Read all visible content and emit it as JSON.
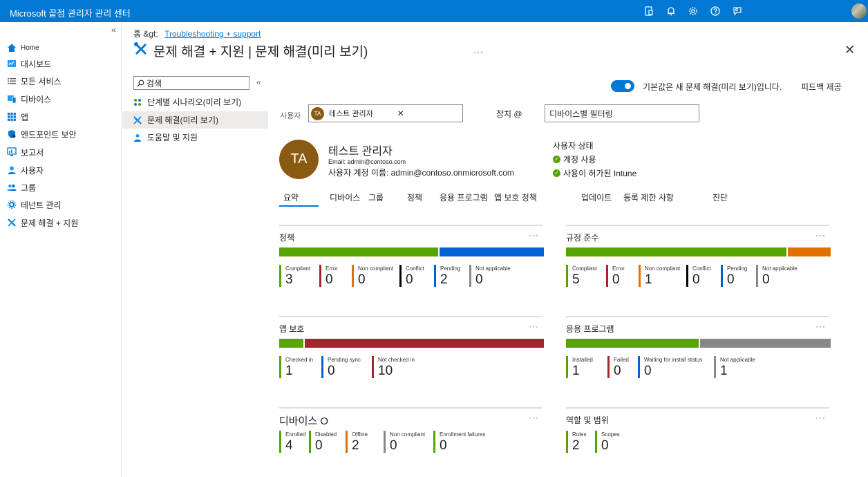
{
  "topbar": {
    "title": "Microsoft 끝점 관리자 관리 센터"
  },
  "nav": {
    "collapse": "«",
    "items": [
      {
        "label": "Home"
      },
      {
        "label": "대시보드"
      },
      {
        "label": "모든 서비스"
      },
      {
        "label": "디바이스"
      },
      {
        "label": "앱"
      },
      {
        "label": "엔드포인트 보안"
      },
      {
        "label": "보고서"
      },
      {
        "label": "사용자"
      },
      {
        "label": "그룹"
      },
      {
        "label": "테넌트 관리"
      },
      {
        "label": "문제 해결 + 지원"
      }
    ]
  },
  "breadcrumb": {
    "home": "홈 &gt;",
    "current": "Troubleshooting + support"
  },
  "page": {
    "title": "문제 해결 + 지원 | 문제 해결(미리 보기)",
    "more": "...",
    "close": "✕"
  },
  "subnav": {
    "search_placeholder": "검색",
    "collapse": "«",
    "items": [
      {
        "label": "단계별 시나리오(미리 보기)"
      },
      {
        "label": "문제 해결(미리 보기)"
      },
      {
        "label": "도움말 및 지원"
      }
    ]
  },
  "toggle": {
    "label": "기본값은 새 문제 해결(미리 보기)입니다.",
    "feedback": "피드백 제공"
  },
  "filters": {
    "user_label": "사용자",
    "user_initials": "TA",
    "user_name": "테스트 관리자",
    "user_remove": "✕",
    "device_label": "장치 @",
    "device_placeholder": "디바이스별 필터링"
  },
  "profile": {
    "initials": "TA",
    "name": "테스트 관리자",
    "email": "Email: admin@contoso.com",
    "upn": "사용자 계정 이름: admin@contoso.onmicrosoft.com",
    "status_title": "사용자 상태",
    "status": [
      "계정 사용",
      "사용이 허가된 Intune"
    ]
  },
  "tabs": [
    "요약",
    "디바이스",
    "그룹",
    "정책",
    "응용 프로그램",
    "앱 보호 정책",
    "업데이트",
    "등록 제한 사항",
    "진단"
  ],
  "cards": {
    "policy": {
      "title": "정책",
      "more": "···",
      "bar": [
        {
          "value": 3,
          "color": "#57a300"
        },
        {
          "value": 2,
          "color": "#0063d4"
        }
      ],
      "stats": [
        {
          "label": "Compliant",
          "value": "3",
          "color": "#57a300"
        },
        {
          "label": "Error",
          "value": "0",
          "color": "#a4262c"
        },
        {
          "label": "Non compliant",
          "value": "0",
          "color": "#e07000"
        },
        {
          "label": "Conflict",
          "value": "0",
          "color": "#000000"
        },
        {
          "label": "Pending",
          "value": "2",
          "color": "#0063d4"
        },
        {
          "label": "Not applicable",
          "value": "0",
          "color": "#8a8886"
        }
      ]
    },
    "compliance": {
      "title": "규정 준수",
      "more": "···",
      "bar": [
        {
          "value": 5,
          "color": "#57a300"
        },
        {
          "value": 1,
          "color": "#e07000"
        }
      ],
      "stats": [
        {
          "label": "Compliant",
          "value": "5",
          "color": "#57a300"
        },
        {
          "label": "Error",
          "value": "0",
          "color": "#a4262c"
        },
        {
          "label": "Non compliant",
          "value": "1",
          "color": "#e07000"
        },
        {
          "label": "Conflict",
          "value": "0",
          "color": "#000000"
        },
        {
          "label": "Pending",
          "value": "0",
          "color": "#0063d4"
        },
        {
          "label": "Not applicable",
          "value": "0",
          "color": "#8a8886"
        }
      ]
    },
    "app_protection": {
      "title": "앱 보호",
      "more": "···",
      "bar": [
        {
          "value": 1,
          "color": "#57a300"
        },
        {
          "value": 10,
          "color": "#a4262c"
        }
      ],
      "stats": [
        {
          "label": "Checked in",
          "value": "1",
          "color": "#57a300"
        },
        {
          "label": "Pending sync",
          "value": "0",
          "color": "#0063d4"
        },
        {
          "label": "Not checked in",
          "value": "10",
          "color": "#a4262c"
        }
      ]
    },
    "applications": {
      "title": "응용 프로그램",
      "more": "···",
      "bar": [
        {
          "value": 1,
          "color": "#57a300"
        },
        {
          "value": 1,
          "color": "#8a8886"
        }
      ],
      "stats": [
        {
          "label": "Installed",
          "value": "1",
          "color": "#57a300"
        },
        {
          "label": "Failed",
          "value": "0",
          "color": "#a4262c"
        },
        {
          "label": "Waiting for install status",
          "value": "0",
          "color": "#0063d4"
        },
        {
          "label": "Not applicable",
          "value": "1",
          "color": "#8a8886"
        }
      ]
    },
    "devices": {
      "title": "디바이스 O",
      "more": "···",
      "stats": [
        {
          "label": "Enrolled",
          "value": "4",
          "color": "#57a300"
        },
        {
          "label": "Disabled",
          "value": "0",
          "color": "#57a300"
        },
        {
          "label": "Offline",
          "value": "2",
          "color": "#e07000"
        },
        {
          "label": "Non compliant",
          "value": "0",
          "color": "#8a8886"
        },
        {
          "label": "Enrollment failures",
          "value": "0",
          "color": "#57a300"
        }
      ]
    },
    "roles": {
      "title": "역할 및 범위",
      "more": "···",
      "stats": [
        {
          "label": "Roles",
          "value": "2",
          "color": "#57a300"
        },
        {
          "label": "Scopes",
          "value": "0",
          "color": "#57a300"
        }
      ]
    }
  }
}
